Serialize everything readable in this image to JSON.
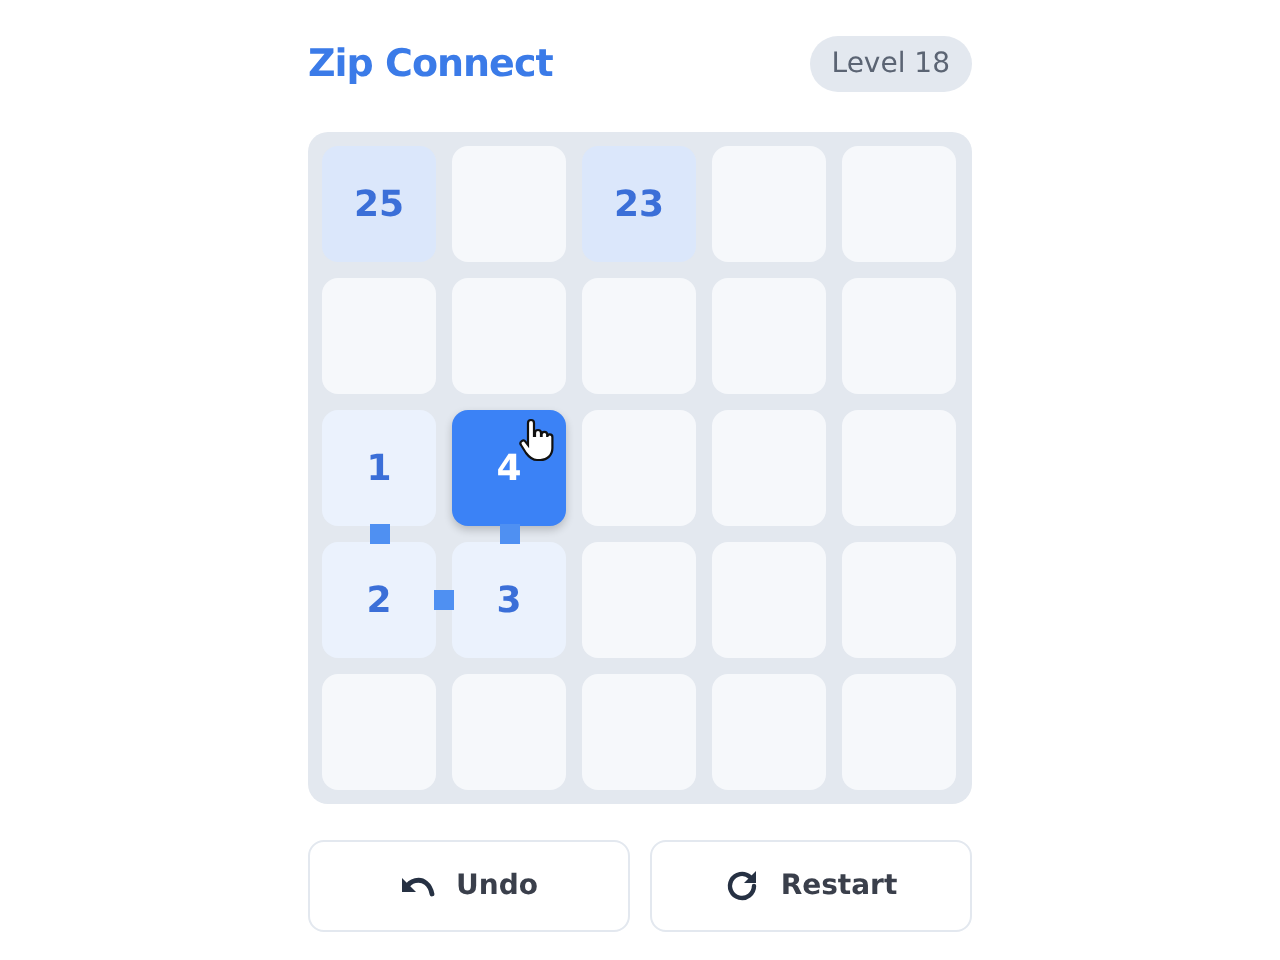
{
  "title": "Zip Connect",
  "level_badge": "Level 18",
  "grid": [
    [
      {
        "label": "25",
        "kind": "clue"
      },
      {
        "kind": "empty"
      },
      {
        "label": "23",
        "kind": "clue"
      },
      {
        "kind": "empty"
      },
      {
        "kind": "empty"
      }
    ],
    [
      {
        "kind": "empty"
      },
      {
        "kind": "empty"
      },
      {
        "kind": "empty"
      },
      {
        "kind": "empty"
      },
      {
        "kind": "empty"
      }
    ],
    [
      {
        "label": "1",
        "kind": "path",
        "link_down": true
      },
      {
        "label": "4",
        "kind": "head",
        "link_down": true
      },
      {
        "kind": "empty"
      },
      {
        "kind": "empty"
      },
      {
        "kind": "empty"
      }
    ],
    [
      {
        "label": "2",
        "kind": "path",
        "link_right": true
      },
      {
        "label": "3",
        "kind": "path"
      },
      {
        "kind": "empty"
      },
      {
        "kind": "empty"
      },
      {
        "kind": "empty"
      }
    ],
    [
      {
        "kind": "empty"
      },
      {
        "kind": "empty"
      },
      {
        "kind": "empty"
      },
      {
        "kind": "empty"
      },
      {
        "kind": "empty"
      }
    ]
  ],
  "buttons": [
    {
      "kind": "undo",
      "label": "Undo"
    },
    {
      "kind": "restart",
      "label": "Restart"
    }
  ]
}
